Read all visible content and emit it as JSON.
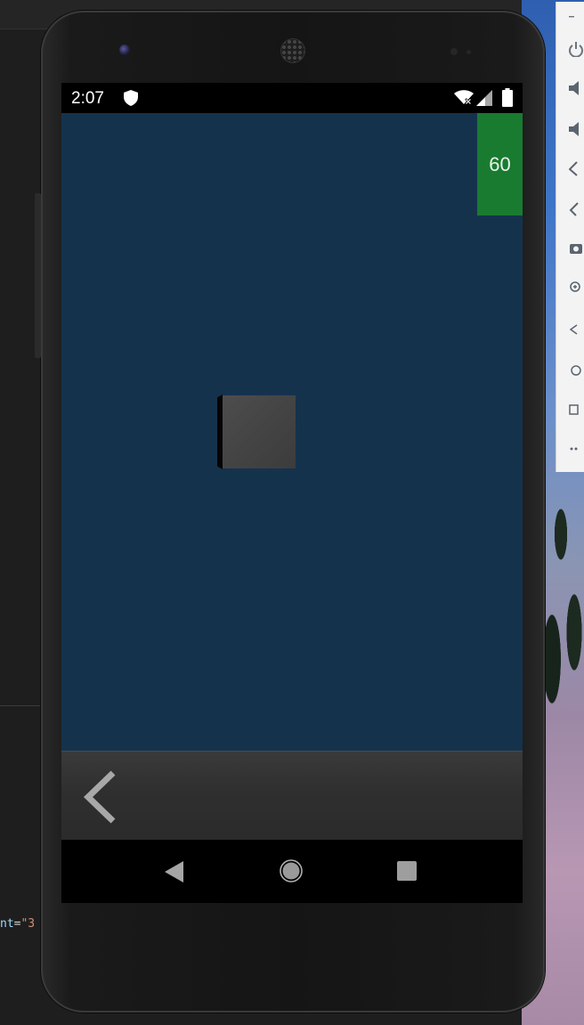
{
  "editor": {
    "code_fragment_attr": "nt",
    "code_fragment_eq": "=",
    "code_fragment_str": "\"3"
  },
  "emulator_toolbar": {
    "items": [
      {
        "icon": "minimize-icon"
      },
      {
        "icon": "power-icon"
      },
      {
        "icon": "volume-up-icon"
      },
      {
        "icon": "volume-down-icon"
      },
      {
        "icon": "rotate-left-icon"
      },
      {
        "icon": "rotate-right-icon"
      },
      {
        "icon": "camera-icon"
      },
      {
        "icon": "zoom-icon"
      },
      {
        "icon": "back-icon"
      },
      {
        "icon": "home-icon"
      },
      {
        "icon": "overview-icon"
      },
      {
        "icon": "more-icon"
      }
    ]
  },
  "status_bar": {
    "time": "2:07"
  },
  "app": {
    "fps": "60",
    "background_color": "#15324d",
    "fps_badge_color": "#197b30"
  }
}
